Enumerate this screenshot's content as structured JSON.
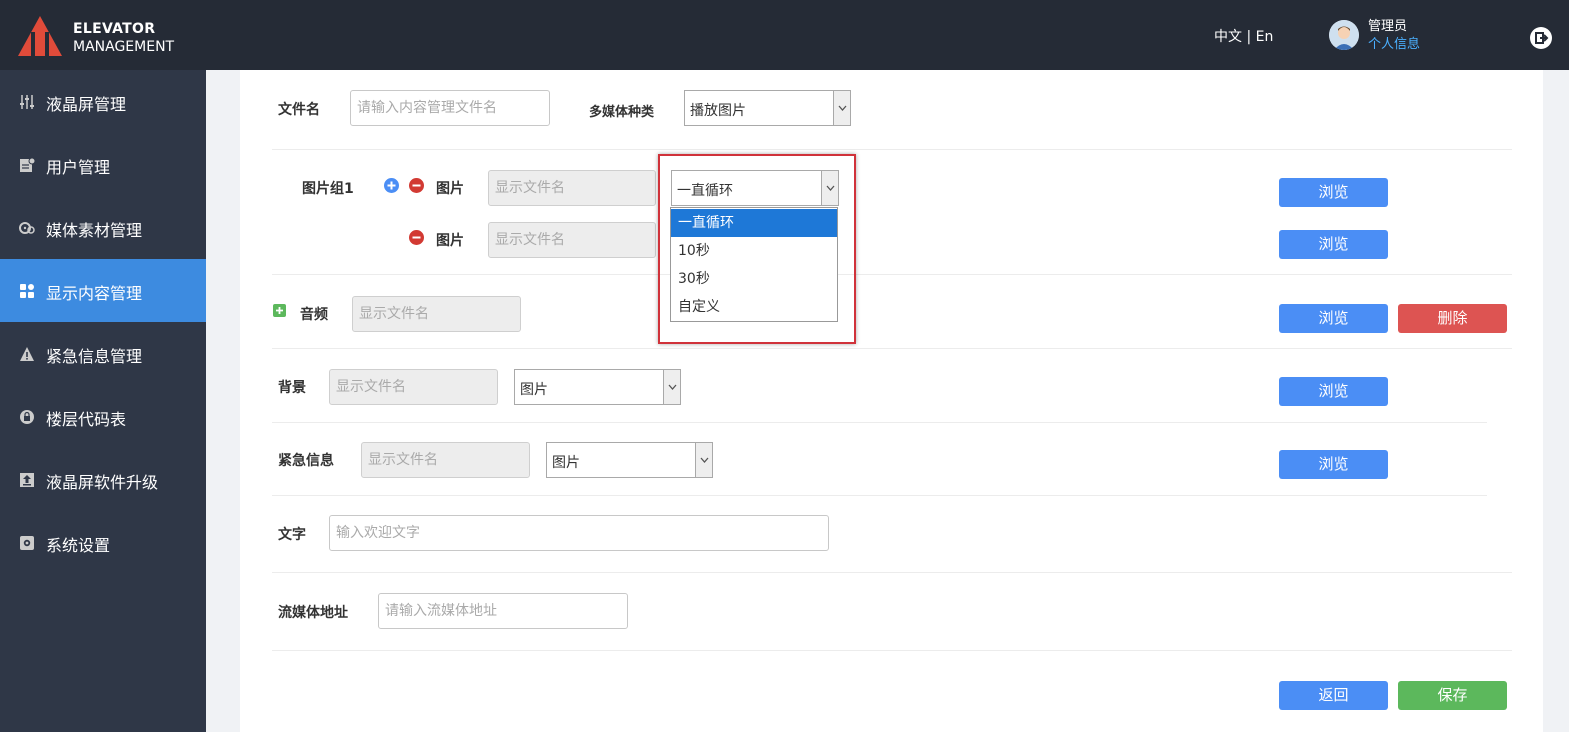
{
  "header": {
    "brand_line1": "ELEVATOR",
    "brand_line2": "MANAGEMENT",
    "lang_zh": "中文",
    "lang_sep": " | ",
    "lang_en": "En",
    "user_name": "管理员",
    "user_info": "个人信息"
  },
  "sidebar": {
    "items": [
      {
        "label": "液晶屏管理",
        "icon": "sliders-icon"
      },
      {
        "label": "用户管理",
        "icon": "user-card-icon"
      },
      {
        "label": "媒体素材管理",
        "icon": "film-reel-icon"
      },
      {
        "label": "显示内容管理",
        "icon": "grid-icon"
      },
      {
        "label": "紧急信息管理",
        "icon": "warning-icon"
      },
      {
        "label": "楼层代码表",
        "icon": "lock-icon"
      },
      {
        "label": "液晶屏软件升级",
        "icon": "upload-icon"
      },
      {
        "label": "系统设置",
        "icon": "settings-icon"
      }
    ],
    "active_index": 3
  },
  "form": {
    "filename_label": "文件名",
    "filename_placeholder": "请输入内容管理文件名",
    "media_type_label": "多媒体种类",
    "media_type_value": "播放图片",
    "image_group_label": "图片组1",
    "image_label": "图片",
    "image2_label": "图片",
    "display_filename_placeholder": "显示文件名",
    "loop_value": "一直循环",
    "loop_options": [
      "一直循环",
      "10秒",
      "30秒",
      "自定义"
    ],
    "audio_label": "音频",
    "background_label": "背景",
    "background_type_value": "图片",
    "emergency_label": "紧急信息",
    "emergency_type_value": "图片",
    "text_label": "文字",
    "text_placeholder": "输入欢迎文字",
    "stream_label": "流媒体地址",
    "stream_placeholder": "请输入流媒体地址",
    "browse_label": "浏览",
    "delete_label": "删除",
    "back_label": "返回",
    "save_label": "保存"
  },
  "colors": {
    "header_bg": "#252b36",
    "sidebar_bg": "#2f3747",
    "active_bg": "#3d8be0",
    "primary": "#4b8ef5",
    "danger": "#dd5452",
    "success": "#5cb85c",
    "link": "#4ab0ff"
  }
}
